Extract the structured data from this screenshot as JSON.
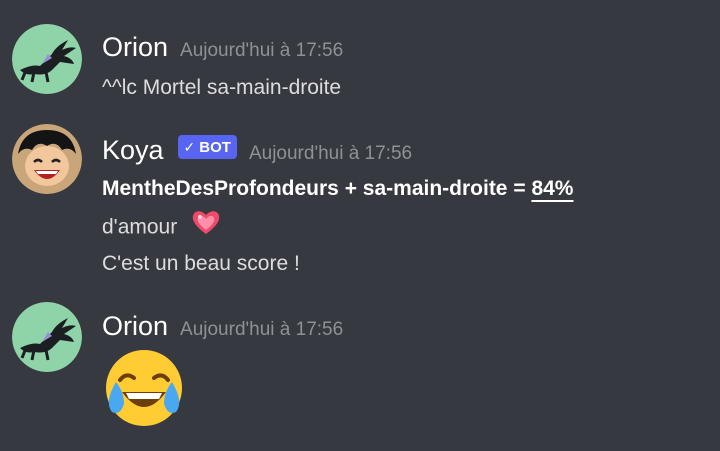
{
  "messages": [
    {
      "username": "Orion",
      "timestamp": "Aujourd'hui à 17:56",
      "lines": [
        "^^lc Mortel sa-main-droite"
      ]
    },
    {
      "username": "Koya",
      "bot_label": "BOT",
      "bot_check": "✓",
      "timestamp": "Aujourd'hui à 17:56",
      "line1_part1": "MentheDesProfondeurs + sa-main-droite = ",
      "line1_percent": "84%",
      "line2": "d'amour",
      "line3": "C'est un beau score !"
    },
    {
      "username": "Orion",
      "timestamp": "Aujourd'hui à 17:56",
      "emoji": "joy-emoji"
    }
  ],
  "icons": {
    "heart": "sparkling-heart-icon",
    "avatar_orion": "dragon-avatar",
    "avatar_koya": "luffy-avatar"
  },
  "colors": {
    "background": "#36393f",
    "username": "#ffffff",
    "timestamp": "#8e9297",
    "text": "#dcddde",
    "bot_tag": "#5865f2",
    "avatar_orion_bg": "#8fd4a8"
  }
}
